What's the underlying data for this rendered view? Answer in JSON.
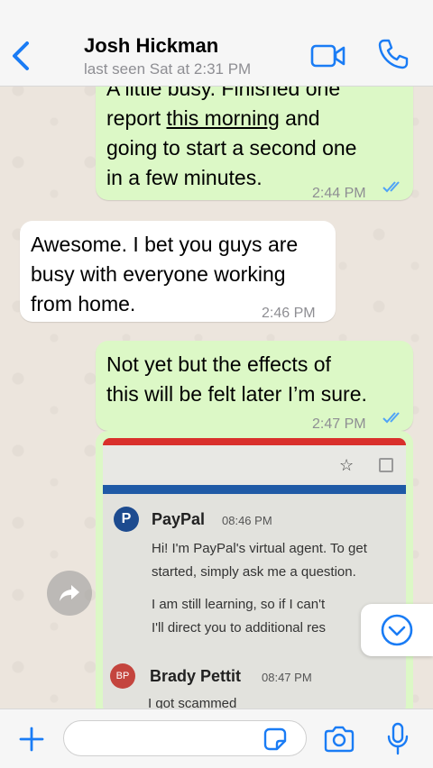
{
  "header": {
    "contact_name": "Josh Hickman",
    "last_seen": "last seen Sat at 2:31 PM"
  },
  "messages": [
    {
      "direction": "outgoing",
      "text_lines": [
        "A little busy. Finished one",
        "report ",
        "this morning",
        " and",
        "going to start a second one",
        "in a few minutes."
      ],
      "time": "2:44 PM",
      "read": true
    },
    {
      "direction": "incoming",
      "text_lines": [
        "Awesome. I bet you guys are",
        "busy with everyone working",
        "from home."
      ],
      "time": "2:46 PM"
    },
    {
      "direction": "outgoing",
      "text_lines": [
        "Not yet but the effects of",
        "this will be felt later I’m sure."
      ],
      "time": "2:47 PM",
      "read": true
    }
  ],
  "image_message": {
    "paypal_logo": "P",
    "paypal_name": "PayPal",
    "paypal_time": "08:46 PM",
    "paypal_lines": [
      "Hi! I'm PayPal's virtual agent. To get",
      "started, simply ask me a question.",
      "I am still learning, so if I can't",
      "I'll direct you to additional res"
    ],
    "user_initials": "BP",
    "user_name": "Brady Pettit",
    "user_time": "08:47 PM",
    "user_line": "I got scammed"
  },
  "input": {
    "placeholder": ""
  },
  "colors": {
    "accent": "#1a7cf5",
    "outgoing_bubble": "#dcf8c6",
    "incoming_bubble": "#ffffff",
    "read_ticks": "#4fa3f7"
  },
  "icons": {
    "back": "chevron-left-icon",
    "video": "video-camera-icon",
    "call": "phone-icon",
    "plus": "plus-icon",
    "sticker": "sticker-icon",
    "camera": "camera-icon",
    "mic": "microphone-icon",
    "forward": "forward-arrow-icon",
    "scroll_down": "chevron-down-circle-icon"
  }
}
